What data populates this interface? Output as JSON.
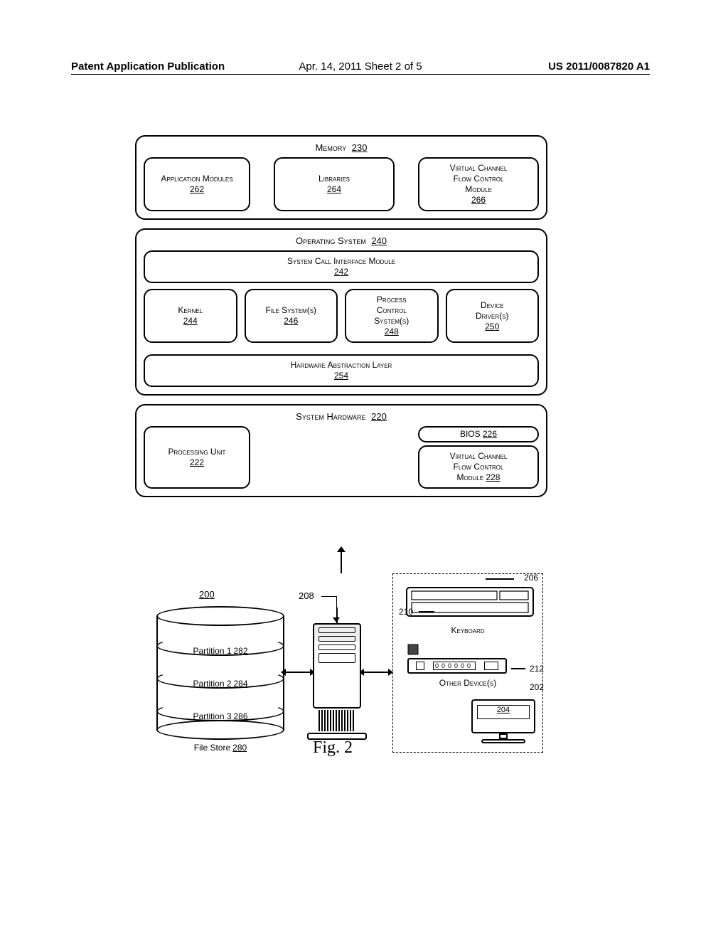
{
  "header": {
    "left": "Patent Application Publication",
    "center": "Apr. 14, 2011  Sheet 2 of 5",
    "right": "US 2011/0087820 A1"
  },
  "memory": {
    "title": "Memory",
    "ref": "230",
    "app_modules": {
      "label": "Application Modules",
      "ref": "262"
    },
    "libraries": {
      "label": "Libraries",
      "ref": "264"
    },
    "vcfm": {
      "line1": "Virtual Channel",
      "line2": "Flow Control",
      "line3": "Module",
      "ref": "266"
    }
  },
  "os": {
    "title": "Operating System",
    "ref": "240",
    "sci": {
      "label": "System Call Interface Module",
      "ref": "242"
    },
    "kernel": {
      "label": "Kernel",
      "ref": "244"
    },
    "fs": {
      "label": "File System(s)",
      "ref": "246"
    },
    "pcs": {
      "line1": "Process",
      "line2": "Control",
      "line3": "System(s)",
      "ref": "248"
    },
    "dd": {
      "line1": "Device",
      "line2": "Driver(s)",
      "ref": "250"
    },
    "hal": {
      "label": "Hardware Abstraction Layer",
      "ref": "254"
    }
  },
  "hw": {
    "title": "System Hardware",
    "ref": "220",
    "pu": {
      "label": "Processing Unit",
      "ref": "222"
    },
    "bios": {
      "label": "BIOS",
      "ref": "226"
    },
    "vcfm": {
      "line1": "Virtual Channel",
      "line2": "Flow Control",
      "line3": "Module",
      "ref": "228"
    }
  },
  "bottom": {
    "ref_200": "200",
    "ref_208": "208",
    "ref_206": "206",
    "ref_210": "210",
    "ref_212": "212",
    "ref_202": "202",
    "keyboard_label": "Keyboard",
    "other_devices_label": "Other Device(s)",
    "monitor_ref": "204",
    "file_store": {
      "p1": {
        "label": "Partition 1",
        "ref": "282"
      },
      "p2": {
        "label": "Partition 2",
        "ref": "284"
      },
      "p3": {
        "label": "Partition 3",
        "ref": "286"
      },
      "caption": "File Store",
      "caption_ref": "280"
    },
    "figure_label": "Fig. 2"
  }
}
